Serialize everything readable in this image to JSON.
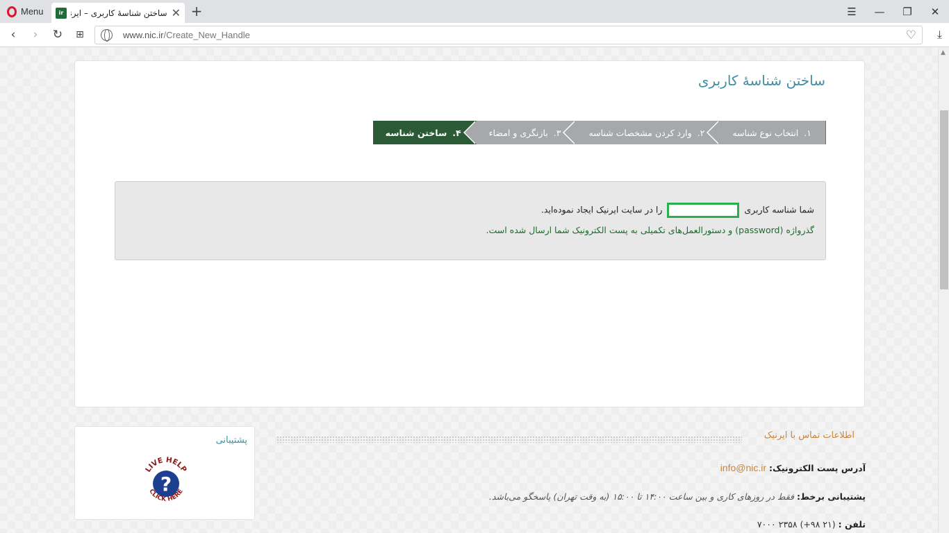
{
  "browser": {
    "menu_label": "Menu",
    "tab_title": "ساختن شناسهٔ کاربری – ایرنیک",
    "favicon_text": "ir",
    "url_host": "www.nic.ir",
    "url_path": "/Create_New_Handle"
  },
  "page": {
    "title": "ساختن شناسهٔ کاربری",
    "steps": [
      {
        "num": "۱.",
        "label": "انتخاب نوع شناسه"
      },
      {
        "num": "۲.",
        "label": "وارد کردن مشخصات شناسه"
      },
      {
        "num": "۳.",
        "label": "بازنگری و امضاء"
      },
      {
        "num": "۴.",
        "label": "ساختن شناسه"
      }
    ],
    "message_prefix": "شما شناسه کاربری",
    "message_suffix": "را در سایت ایرنیک ایجاد نموده‌اید.",
    "message_line2": "گذرواژه (password) و دستورالعمل‌های تکمیلی به پست الکترونیک شما ارسال شده است."
  },
  "support": {
    "title": "پشتیبانی",
    "badge_top": "LIVE HELP",
    "badge_bottom": "CLICK HERE",
    "badge_mark": "?"
  },
  "contact": {
    "heading": "اطلاعات تماس با ایرنیک",
    "email_label": "آدرس پست الکترونیک:",
    "email": "info@nic.ir",
    "support_label": "پشتیبانی برخط:",
    "support_text": "فقط در روزهای کاری و بین ساعت ۱۴:۰۰ تا ۱۵:۰۰ (به وقت تهران) پاسخگو می‌باشد.",
    "phone_label": "تلفن :",
    "phone": "(۲۱ ۹۸+) ۲۳۵۸ ۷۰۰۰"
  },
  "colors": {
    "active_step": "#2b5a37",
    "inactive_step": "#a7a8aa",
    "title_teal": "#3f8fa0",
    "highlight_green": "#26b14a",
    "contact_orange": "#c9853c"
  }
}
